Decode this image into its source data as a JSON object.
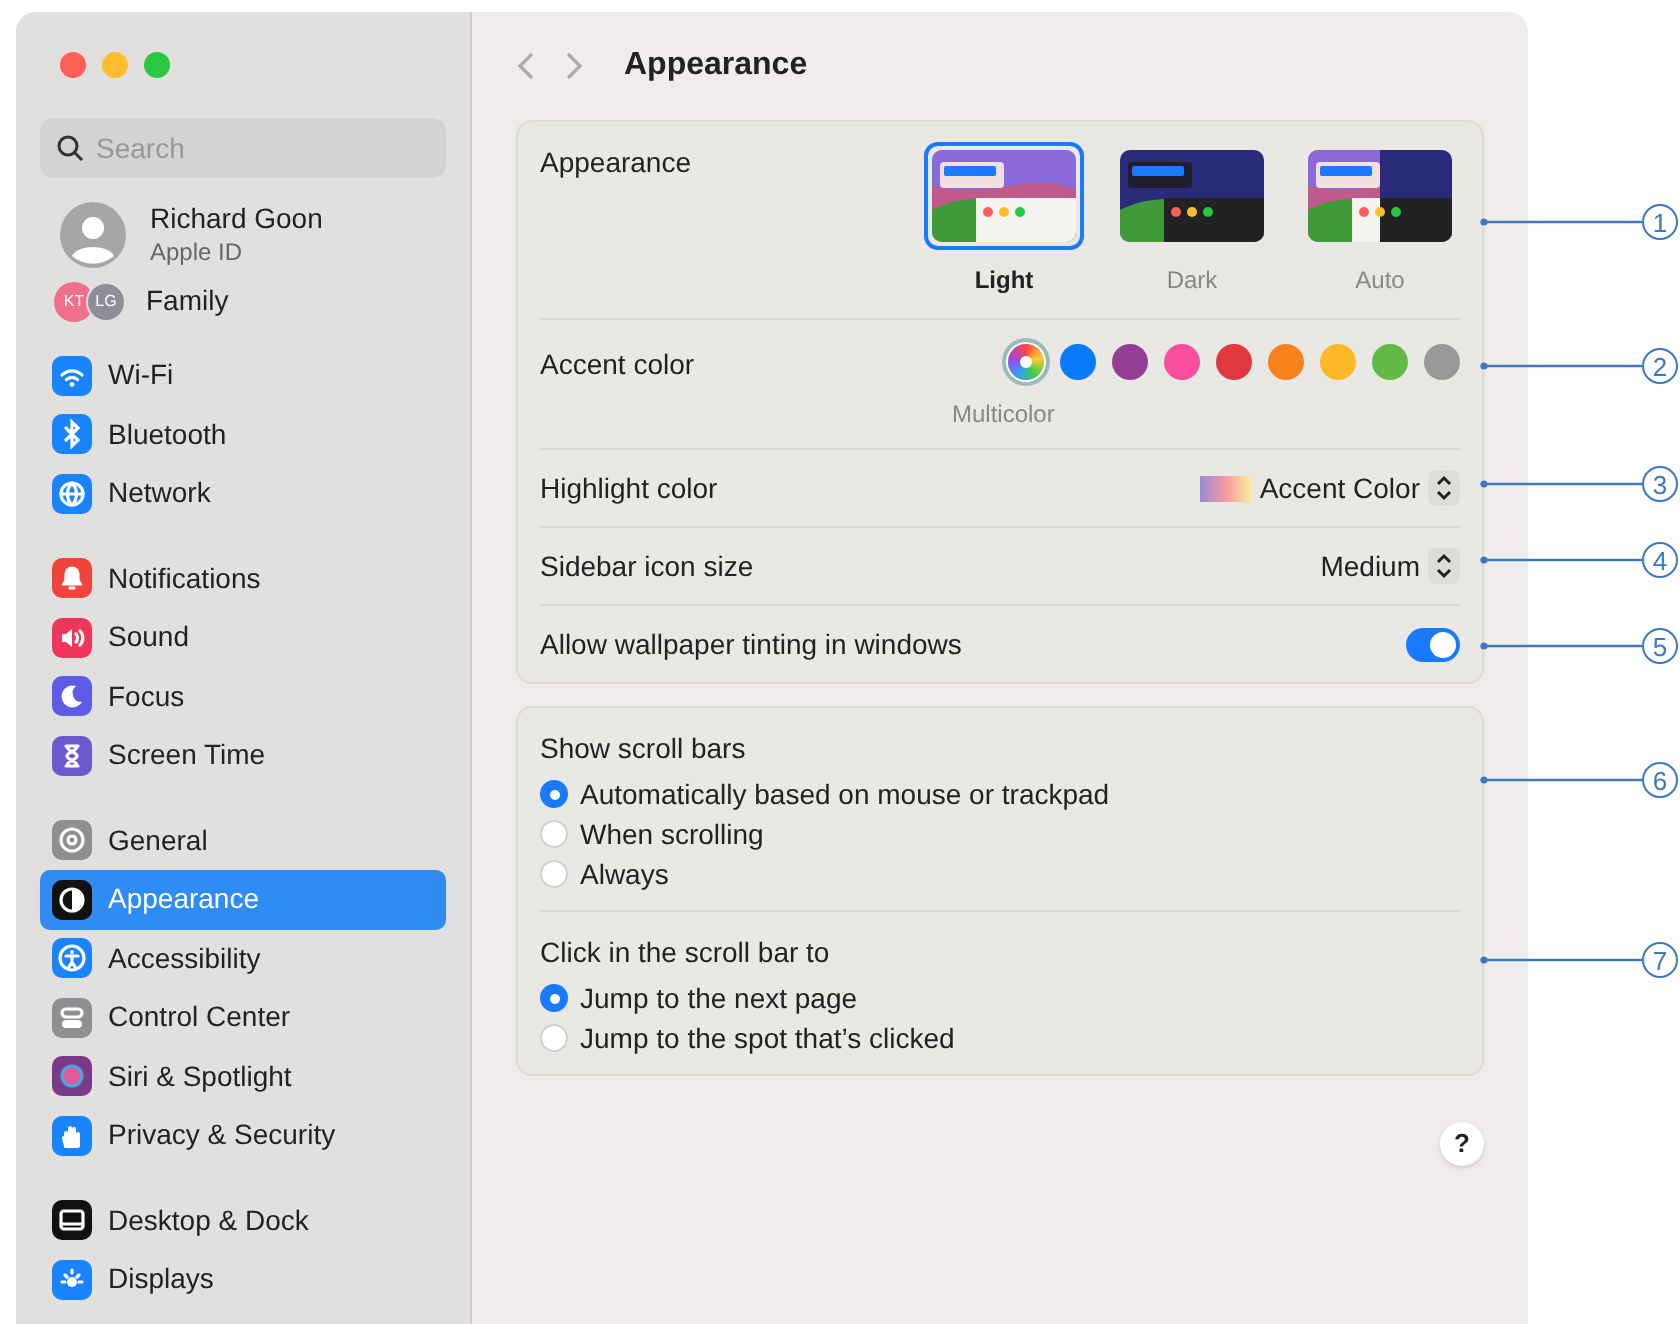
{
  "window": {
    "title": "Appearance"
  },
  "sidebar": {
    "search": {
      "placeholder": "Search"
    },
    "account": {
      "name": "Richard Goon",
      "subtitle": "Apple ID"
    },
    "family": {
      "label": "Family",
      "members": [
        {
          "initials": "KT",
          "color": "#f0708a"
        },
        {
          "initials": "LG",
          "color": "#8e8e99"
        }
      ]
    },
    "groups": [
      [
        {
          "label": "Wi-Fi",
          "kind": "wifi",
          "color": "#1a84ff",
          "selected": false
        },
        {
          "label": "Bluetooth",
          "kind": "bluetooth",
          "color": "#1a84ff",
          "selected": false
        },
        {
          "label": "Network",
          "kind": "globe",
          "color": "#1a84ff",
          "selected": false
        }
      ],
      [
        {
          "label": "Notifications",
          "kind": "bell",
          "color": "#f0453a",
          "selected": false
        },
        {
          "label": "Sound",
          "kind": "sound",
          "color": "#f0365a",
          "selected": false
        },
        {
          "label": "Focus",
          "kind": "moon",
          "color": "#5e5ce6",
          "selected": false
        },
        {
          "label": "Screen Time",
          "kind": "hourglass",
          "color": "#6a5acd",
          "selected": false
        }
      ],
      [
        {
          "label": "General",
          "kind": "gear",
          "color": "#8e8e93",
          "selected": false
        },
        {
          "label": "Appearance",
          "kind": "contrast",
          "color": "#111111",
          "selected": true
        },
        {
          "label": "Accessibility",
          "kind": "person",
          "color": "#1a84ff",
          "selected": false
        },
        {
          "label": "Control Center",
          "kind": "toggles",
          "color": "#8e8e93",
          "selected": false
        },
        {
          "label": "Siri & Spotlight",
          "kind": "orb",
          "color": "#7a3a8a",
          "selected": false
        },
        {
          "label": "Privacy & Security",
          "kind": "hand",
          "color": "#1a84ff",
          "selected": false
        }
      ],
      [
        {
          "label": "Desktop & Dock",
          "kind": "dock",
          "color": "#111111",
          "selected": false
        },
        {
          "label": "Displays",
          "kind": "sun",
          "color": "#1a84ff",
          "selected": false
        }
      ]
    ]
  },
  "appearance": {
    "label": "Appearance",
    "options": [
      {
        "label": "Light",
        "kind": "light",
        "selected": true
      },
      {
        "label": "Dark",
        "kind": "dark",
        "selected": false
      },
      {
        "label": "Auto",
        "kind": "auto",
        "selected": false
      }
    ]
  },
  "accent": {
    "label": "Accent color",
    "selected_name": "Multicolor",
    "swatches": [
      {
        "kind": "multicolor",
        "selected": true
      },
      {
        "kind": "solid",
        "color": "#0a7aff",
        "selected": false
      },
      {
        "kind": "solid",
        "color": "#953d96",
        "selected": false
      },
      {
        "kind": "solid",
        "color": "#f74f9e",
        "selected": false
      },
      {
        "kind": "solid",
        "color": "#e0383e",
        "selected": false
      },
      {
        "kind": "solid",
        "color": "#f7821b",
        "selected": false
      },
      {
        "kind": "solid",
        "color": "#fcb827",
        "selected": false
      },
      {
        "kind": "solid",
        "color": "#62ba46",
        "selected": false
      },
      {
        "kind": "solid",
        "color": "#989898",
        "selected": false
      }
    ]
  },
  "highlight": {
    "label": "Highlight color",
    "value": "Accent Color"
  },
  "icon_size": {
    "label": "Sidebar icon size",
    "value": "Medium"
  },
  "tinting": {
    "label": "Allow wallpaper tinting in windows",
    "on": true
  },
  "scroll_groups": [
    {
      "label": "Show scroll bars",
      "options": [
        {
          "label": "Automatically based on mouse or trackpad",
          "selected": true
        },
        {
          "label": "When scrolling",
          "selected": false
        },
        {
          "label": "Always",
          "selected": false
        }
      ]
    },
    {
      "label": "Click in the scroll bar to",
      "options": [
        {
          "label": "Jump to the next page",
          "selected": true
        },
        {
          "label": "Jump to the spot that’s clicked",
          "selected": false
        }
      ]
    }
  ],
  "help": {
    "label": "?"
  },
  "callouts": [
    "1",
    "2",
    "3",
    "4",
    "5",
    "6",
    "7"
  ]
}
